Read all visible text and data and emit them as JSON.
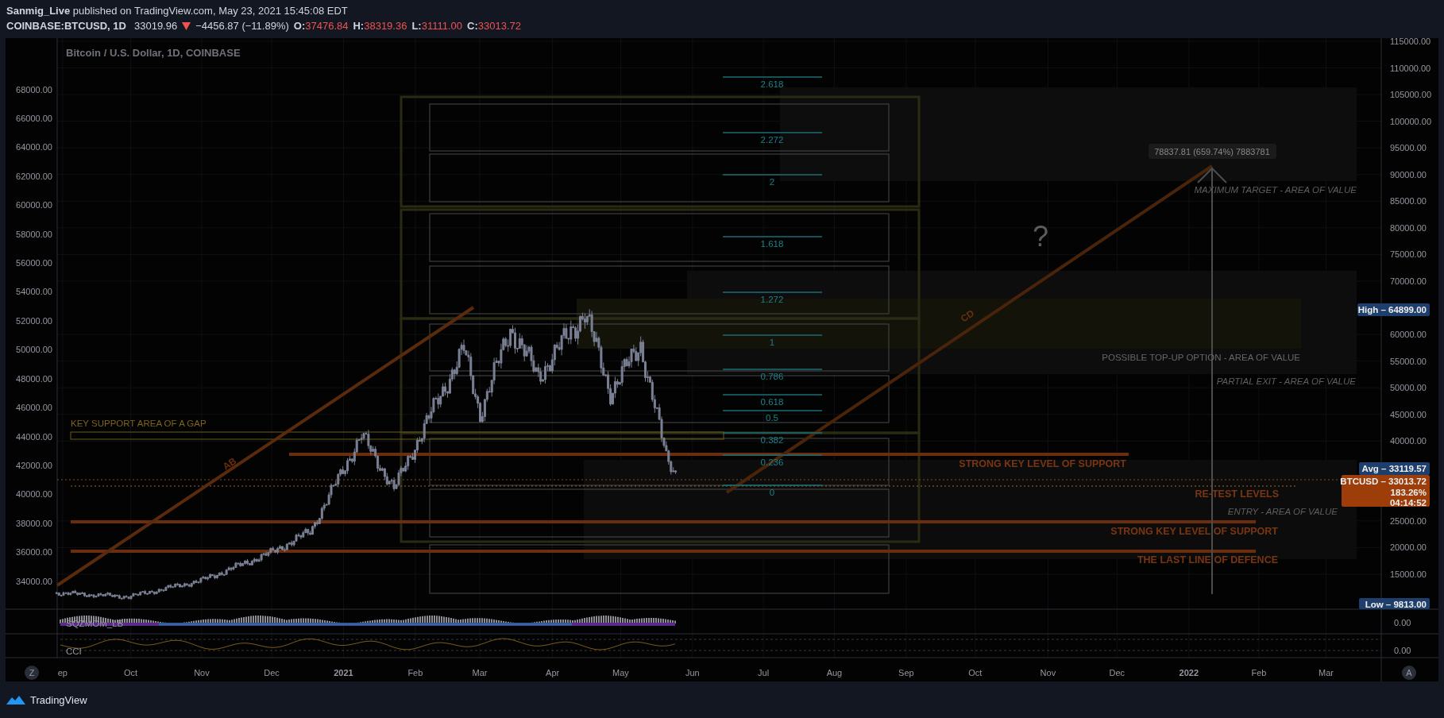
{
  "header": {
    "author": "Sanmig_Live",
    "published": "published on TradingView.com, May 23, 2021 15:45:08 EDT"
  },
  "quote": {
    "symbol": "COINBASE:BTCUSD, 1D",
    "last": "33019.96",
    "change": "−4456.87 (−11.89%)",
    "ohlc": [
      {
        "label": "O:",
        "value": "37476.84"
      },
      {
        "label": "H:",
        "value": "38319.36"
      },
      {
        "label": "L:",
        "value": "31111.00"
      },
      {
        "label": "C:",
        "value": "33013.72"
      }
    ]
  },
  "chart": {
    "title": "Bitcoin / U.S. Dollar, 1D, COINBASE",
    "left_axis": [
      "68000.00",
      "66000.00",
      "64000.00",
      "62000.00",
      "60000.00",
      "58000.00",
      "56000.00",
      "54000.00",
      "52000.00",
      "50000.00",
      "48000.00",
      "46000.00",
      "44000.00",
      "42000.00",
      "40000.00",
      "38000.00",
      "36000.00",
      "34000.00"
    ],
    "right_axis": [
      "115000.00",
      "110000.00",
      "105000.00",
      "100000.00",
      "95000.00",
      "90000.00",
      "85000.00",
      "80000.00",
      "75000.00",
      "70000.00",
      "60000.00",
      "55000.00",
      "50000.00",
      "45000.00",
      "40000.00",
      "25000.00",
      "20000.00",
      "15000.00"
    ],
    "time_axis": [
      {
        "label": "ep",
        "kind": "month"
      },
      {
        "label": "Oct",
        "kind": "month"
      },
      {
        "label": "Nov",
        "kind": "month"
      },
      {
        "label": "Dec",
        "kind": "month"
      },
      {
        "label": "2021",
        "kind": "year"
      },
      {
        "label": "Feb",
        "kind": "month"
      },
      {
        "label": "Mar",
        "kind": "month"
      },
      {
        "label": "Apr",
        "kind": "month"
      },
      {
        "label": "May",
        "kind": "month"
      },
      {
        "label": "Jun",
        "kind": "month"
      },
      {
        "label": "Jul",
        "kind": "month"
      },
      {
        "label": "Aug",
        "kind": "month"
      },
      {
        "label": "Sep",
        "kind": "month"
      },
      {
        "label": "Oct",
        "kind": "month"
      },
      {
        "label": "Nov",
        "kind": "month"
      },
      {
        "label": "Dec",
        "kind": "month"
      },
      {
        "label": "2022",
        "kind": "year"
      },
      {
        "label": "Feb",
        "kind": "month"
      },
      {
        "label": "Mar",
        "kind": "month"
      }
    ],
    "price_badges": [
      {
        "kind": "high",
        "text": "High – 64899.00"
      },
      {
        "kind": "avg",
        "text": "Avg – 33119.57"
      },
      {
        "kind": "last",
        "text": "BTCUSD – 33013.72",
        "lines": [
          "183.26%",
          "04:14:52"
        ]
      },
      {
        "kind": "low",
        "text": "Low – 9813.00"
      }
    ],
    "fib_levels": [
      "2.618",
      "2.272",
      "2",
      "1.618",
      "1.272",
      "1",
      "0.786",
      "0.618",
      "0.5",
      "0.382",
      "0.236",
      "0"
    ],
    "annotations": [
      {
        "kind": "italic",
        "text": "MAXIMUM TARGET - AREA OF VALUE"
      },
      {
        "kind": "plain",
        "text": "POSSIBLE TOP-UP OPTION - AREA OF VALUE"
      },
      {
        "kind": "italic",
        "text": "PARTIAL EXIT - AREA OF VALUE"
      },
      {
        "kind": "level",
        "text": "STRONG KEY LEVEL OF SUPPORT"
      },
      {
        "kind": "level",
        "text": "RE-TEST LEVELS"
      },
      {
        "kind": "italic",
        "text": "ENTRY - AREA OF VALUE"
      },
      {
        "kind": "level",
        "text": "STRONG KEY LEVEL OF SUPPORT"
      },
      {
        "kind": "level",
        "text": "THE LAST LINE OF DEFENCE"
      },
      {
        "kind": "gap",
        "text": "KEY SUPPORT AREA OF A GAP"
      }
    ],
    "measure_label": "78837.81 (659.74%) 7883781",
    "question": "?",
    "trend_labels": [
      "AB",
      "CD"
    ]
  },
  "indicators": [
    {
      "name": "SQZMOM_LB",
      "value": "0.00"
    },
    {
      "name": "CCI",
      "value": "0.00"
    }
  ],
  "scale_buttons": [
    "Z",
    "A"
  ],
  "footer": {
    "brand": "TradingView"
  }
}
